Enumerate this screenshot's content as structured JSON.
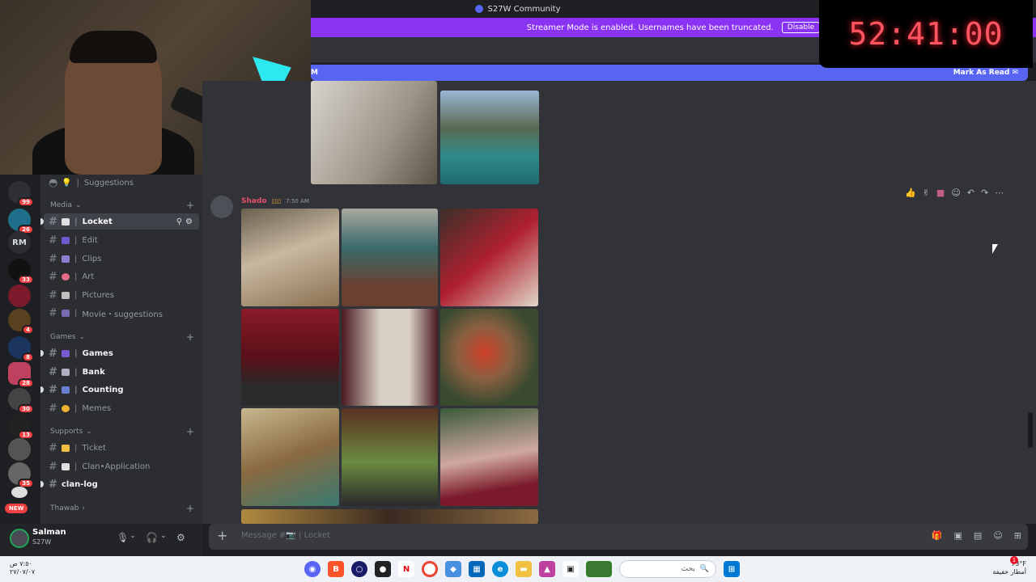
{
  "titlebar": {
    "title": "S27W Community"
  },
  "banner": {
    "text": "Streamer Mode is enabled. Usernames have been truncated.",
    "button": "Disable"
  },
  "newbar": {
    "left": "M",
    "mark_read": "Mark As Read"
  },
  "timer": {
    "value": "52:41:00"
  },
  "rail": {
    "servers": [
      {
        "label": "",
        "badge": "99"
      },
      {
        "label": "",
        "badge": "26"
      },
      {
        "label": "RM",
        "badge": ""
      },
      {
        "label": "",
        "badge": "33"
      },
      {
        "label": "",
        "badge": ""
      },
      {
        "label": "",
        "badge": "4"
      },
      {
        "label": "",
        "badge": "8"
      },
      {
        "label": "",
        "badge": "28"
      },
      {
        "label": "",
        "badge": "30"
      },
      {
        "label": "",
        "badge": "13"
      },
      {
        "label": "",
        "badge": ""
      },
      {
        "label": "",
        "badge": "35"
      }
    ],
    "new_label": "NEW"
  },
  "sidebar": {
    "top_channel": "Suggestions",
    "categories": {
      "media": "Media",
      "games": "Games",
      "supports": "Supports",
      "thawab": "Thawab"
    },
    "channels": {
      "locket": "Locket",
      "edit": "Edit",
      "clips": "Clips",
      "art": "Art",
      "pictures": "Pictures",
      "movie": "Movie・suggestions",
      "games": "Games",
      "bank": "Bank",
      "counting": "Counting",
      "memes": "Memes",
      "ticket": "Ticket",
      "clan_application": "Clan•Application",
      "clan_log": "clan-log"
    }
  },
  "user": {
    "name": "Salman",
    "status": "S27W"
  },
  "message": {
    "author": "Shado",
    "tag": "▯▯▯",
    "time": "7:50 AM"
  },
  "composer": {
    "placeholder": "Message #📷 | Locket"
  },
  "taskbar": {
    "clock_time": "٧:٥٠ ص",
    "clock_date": "٢٧/٠٧/٠٧",
    "search": "بحث",
    "weather_temp": "73°F",
    "weather_desc": "أمطار خفيفة",
    "notif": "1"
  },
  "colors": {
    "accent": "#5865f2",
    "banner": "#8a33f2",
    "timer": "#ff5560",
    "badge": "#f23f42"
  }
}
